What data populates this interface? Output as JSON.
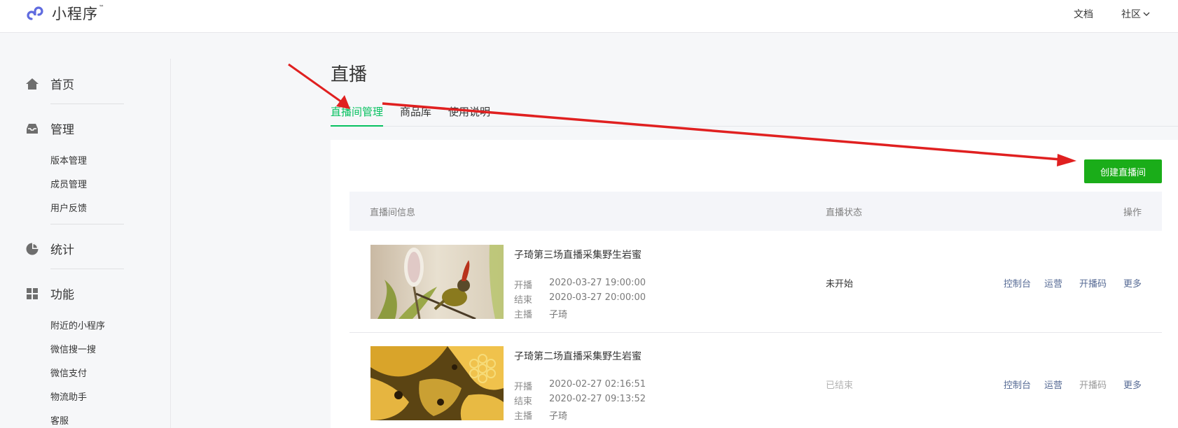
{
  "header": {
    "logo_text": "小程序",
    "logo_tm": "™",
    "docs": "文档",
    "community": "社区"
  },
  "sidebar": {
    "home": "首页",
    "manage": "管理",
    "manage_items": [
      "版本管理",
      "成员管理",
      "用户反馈"
    ],
    "stats": "统计",
    "features": "功能",
    "feature_items": [
      "附近的小程序",
      "微信搜一搜",
      "微信支付",
      "物流助手",
      "客服"
    ]
  },
  "main": {
    "title": "直播",
    "tabs": [
      "直播间管理",
      "商品库",
      "使用说明"
    ],
    "create_button": "创建直播间",
    "columns": [
      "直播间信息",
      "直播状态",
      "操作"
    ],
    "meta_labels": {
      "start": "开播",
      "end": "结束",
      "host": "主播"
    },
    "actions": [
      "控制台",
      "运营",
      "开播码",
      "更多"
    ],
    "rooms": [
      {
        "title": "子琦第三场直播采集野生岩蜜",
        "start": "2020-03-27 19:00:00",
        "end": "2020-03-27 20:00:00",
        "host": "子琦",
        "status": "未开始"
      },
      {
        "title": "子琦第二场直播采集野生岩蜜",
        "start": "2020-02-27 02:16:51",
        "end": "2020-02-27 09:13:52",
        "host": "子琦",
        "status": "已结束"
      }
    ]
  },
  "colors": {
    "brand_green": "#07c160",
    "button_green": "#1aad19",
    "link_blue": "#576b95",
    "annotation_red": "#e02020"
  }
}
